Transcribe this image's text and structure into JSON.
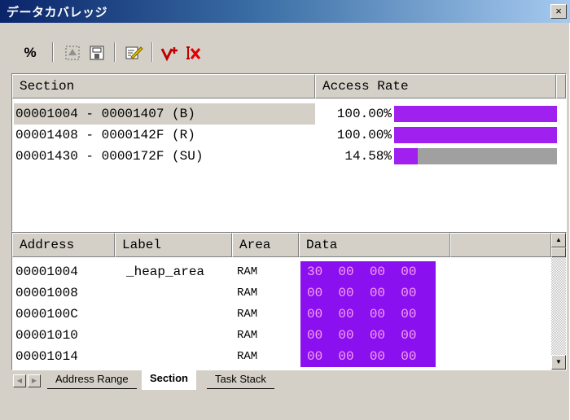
{
  "window": {
    "title": "データカバレッジ",
    "close_glyph": "×"
  },
  "toolbar": {
    "percent_label": "%",
    "buttons": [
      {
        "icon": "range-select-icon"
      },
      {
        "icon": "save-icon"
      },
      {
        "icon": "edit-icon"
      },
      {
        "icon": "add-range-icon"
      },
      {
        "icon": "delete-range-icon"
      }
    ]
  },
  "sections": {
    "columns": [
      "Section",
      "Access Rate"
    ],
    "rows": [
      {
        "range": "00001004 - 00001407 (B)",
        "rate_text": "100.00%",
        "rate": 1.0,
        "selected": true
      },
      {
        "range": "00001408 - 0000142F (R)",
        "rate_text": "100.00%",
        "rate": 1.0,
        "selected": false
      },
      {
        "range": "00001430 - 0000172F (SU)",
        "rate_text": "14.58%",
        "rate": 0.1458,
        "selected": false
      }
    ],
    "bar_color": "#a020f0",
    "bar_bg": "#a0a0a0"
  },
  "data_view": {
    "columns": [
      "Address",
      "Label",
      "Area",
      "Data"
    ],
    "rows": [
      {
        "address": "00001004",
        "label": "_heap_area",
        "area": "RAM",
        "data": "30  00  00  00"
      },
      {
        "address": "00001008",
        "label": "",
        "area": "RAM",
        "data": "00  00  00  00"
      },
      {
        "address": "0000100C",
        "label": "",
        "area": "RAM",
        "data": "00  00  00  00"
      },
      {
        "address": "00001010",
        "label": "",
        "area": "RAM",
        "data": "00  00  00  00"
      },
      {
        "address": "00001014",
        "label": "",
        "area": "RAM",
        "data": "00  00  00  00"
      }
    ]
  },
  "tabs": [
    "Address Range",
    "Section",
    "Task Stack"
  ],
  "active_tab": "Section"
}
